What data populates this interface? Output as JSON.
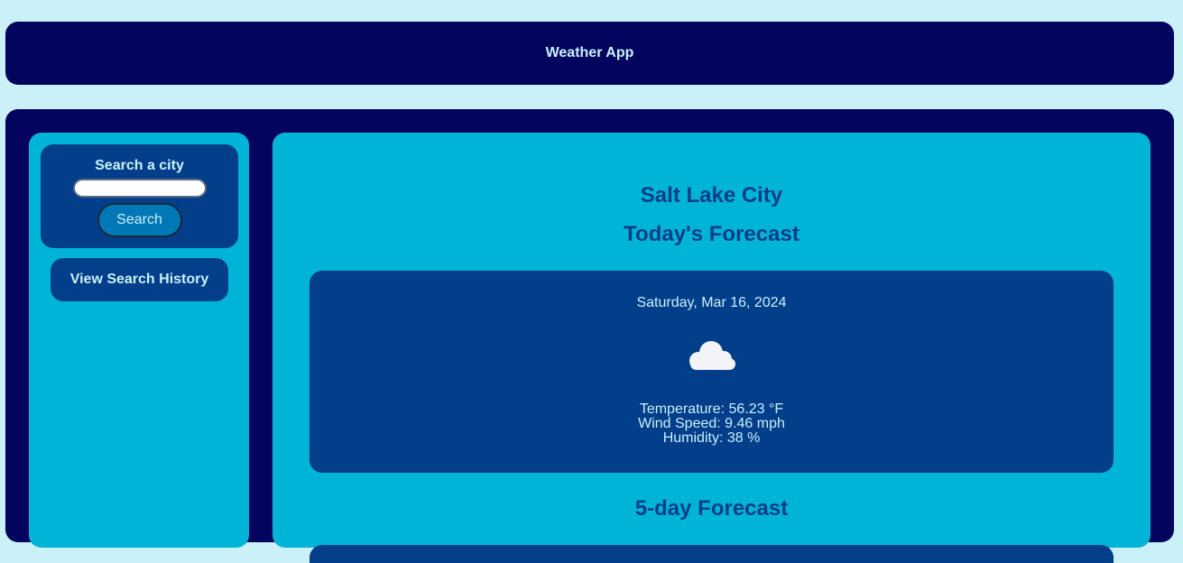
{
  "header": {
    "title": "Weather App"
  },
  "sidebar": {
    "search_label": "Search a city",
    "search_input_value": "",
    "search_input_placeholder": "",
    "search_button_label": "Search",
    "history_button_label": "View Search History"
  },
  "main": {
    "city": "Salt Lake City",
    "todays_heading": "Today's Forecast",
    "today": {
      "date": "Saturday, Mar 16, 2024",
      "icon": "cloud-icon",
      "temperature": "Temperature: 56.23 °F",
      "wind_speed": "Wind Speed: 9.46 mph",
      "humidity": "Humidity: 38 %"
    },
    "five_day_heading": "5-day Forecast"
  },
  "colors": {
    "page_background": "#caf0f8",
    "dark_navy": "#03045e",
    "panel_cyan": "#00b4d8",
    "card_blue": "#023e8a",
    "button_blue": "#0077b6",
    "light_text": "#caf0f8"
  }
}
